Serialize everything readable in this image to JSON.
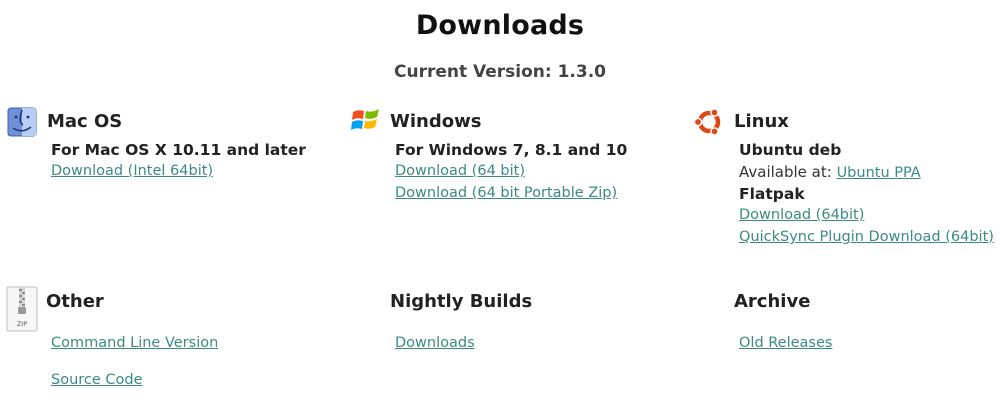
{
  "page": {
    "title": "Downloads",
    "version": "Current Version: 1.3.0"
  },
  "macos": {
    "heading": "Mac OS",
    "requirement": "For Mac OS X 10.11 and later",
    "links": [
      "Download (Intel 64bit)"
    ]
  },
  "windows": {
    "heading": "Windows",
    "requirement": "For Windows 7, 8.1 and 10",
    "links": [
      "Download (64 bit)",
      "Download (64 bit Portable Zip)"
    ]
  },
  "linux": {
    "heading": "Linux",
    "ubuntu_label": "Ubuntu deb",
    "available_prefix": "Available at: ",
    "ubuntu_link": "Ubuntu PPA",
    "flatpak_label": "Flatpak",
    "links": [
      "Download (64bit)",
      "QuickSync Plugin Download (64bit)"
    ]
  },
  "other": {
    "heading": "Other",
    "zip_text": "ZIP",
    "links": [
      "Command Line Version",
      "Source Code"
    ]
  },
  "nightly": {
    "heading": "Nightly Builds",
    "links": [
      "Downloads"
    ]
  },
  "archive": {
    "heading": "Archive",
    "links": [
      "Old Releases"
    ]
  },
  "colors": {
    "link": "#3b8a85",
    "ubuntu_orange": "#dd4814"
  }
}
